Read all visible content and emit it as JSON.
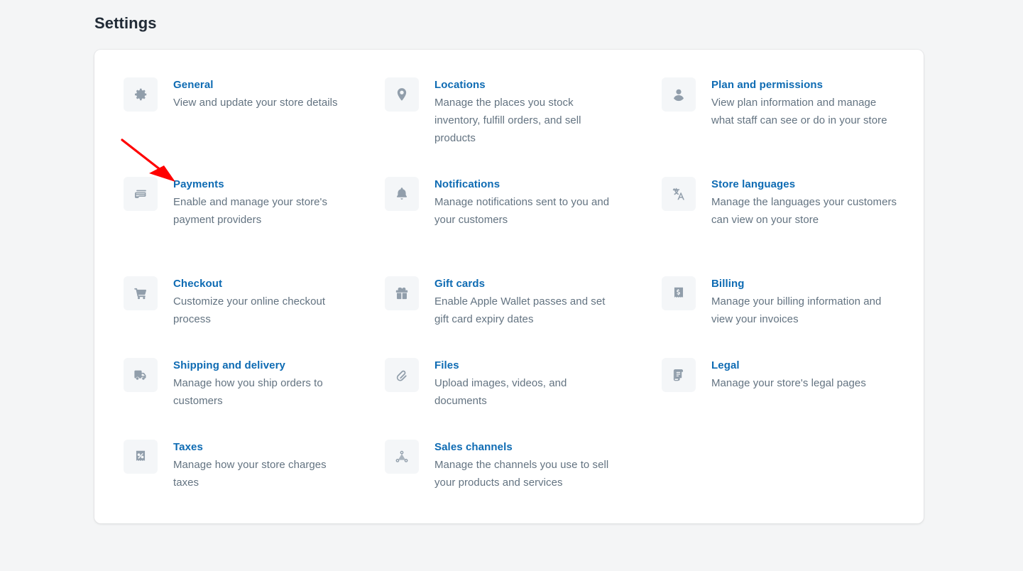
{
  "page": {
    "title": "Settings",
    "background_color": "#F4F5F6",
    "card_background": "#FFFFFF",
    "link_color": "#0E6BB3",
    "description_color": "#637381",
    "icon_color": "#919EAB",
    "icon_tile_color": "#F4F6F8",
    "annotation_color": "#FF0000"
  },
  "settings": {
    "columns": [
      {
        "items": [
          {
            "icon": "gear-icon",
            "title": "General",
            "description": "View and update your store details"
          },
          {
            "icon": "payment-card-icon",
            "title": "Payments",
            "description": "Enable and manage your store's payment providers"
          },
          {
            "icon": "shopping-cart-icon",
            "title": "Checkout",
            "description": "Customize your online checkout process"
          },
          {
            "icon": "delivery-truck-icon",
            "title": "Shipping and delivery",
            "description": "Manage how you ship orders to customers"
          },
          {
            "icon": "tax-receipt-icon",
            "title": "Taxes",
            "description": "Manage how your store charges taxes"
          }
        ]
      },
      {
        "items": [
          {
            "icon": "location-pin-icon",
            "title": "Locations",
            "description": "Manage the places you stock inventory, fulfill orders, and sell products"
          },
          {
            "icon": "bell-icon",
            "title": "Notifications",
            "description": "Manage notifications sent to you and your customers"
          },
          {
            "icon": "gift-card-icon",
            "title": "Gift cards",
            "description": "Enable Apple Wallet passes and set gift card expiry dates"
          },
          {
            "icon": "paperclip-icon",
            "title": "Files",
            "description": "Upload images, videos, and documents"
          },
          {
            "icon": "sales-channels-icon",
            "title": "Sales channels",
            "description": "Manage the channels you use to sell your products and services"
          }
        ]
      },
      {
        "items": [
          {
            "icon": "person-icon",
            "title": "Plan and permissions",
            "description": "View plan information and manage what staff can see or do in your store"
          },
          {
            "icon": "translate-icon",
            "title": "Store languages",
            "description": "Manage the languages your customers can view on your store"
          },
          {
            "icon": "billing-receipt-icon",
            "title": "Billing",
            "description": "Manage your billing information and view your invoices"
          },
          {
            "icon": "legal-scroll-icon",
            "title": "Legal",
            "description": "Manage your store's legal pages"
          }
        ]
      }
    ]
  },
  "annotation": {
    "type": "arrow",
    "points_to": "Payments",
    "color": "#FF0000"
  }
}
